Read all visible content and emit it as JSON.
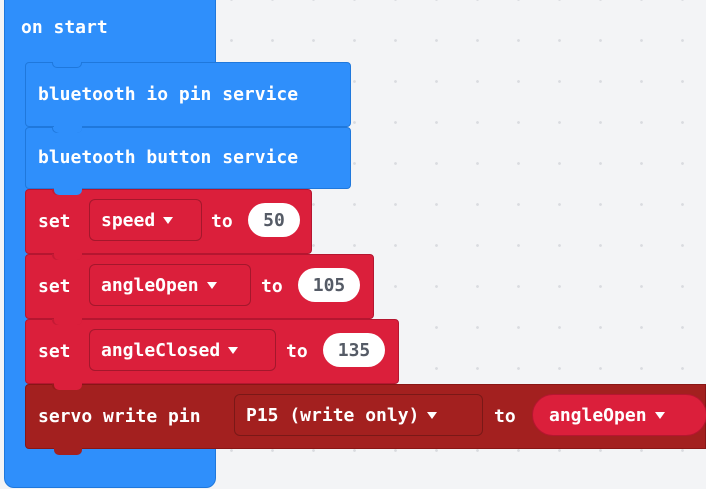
{
  "hat": {
    "label": "on start"
  },
  "bluetooth_io": {
    "label": "bluetooth io pin service"
  },
  "bluetooth_button": {
    "label": "bluetooth button service"
  },
  "set_speed": {
    "set_label": "set",
    "variable": "speed",
    "to_label": "to",
    "value": "50"
  },
  "set_angle_open": {
    "set_label": "set",
    "variable": "angleOpen",
    "to_label": "to",
    "value": "105"
  },
  "set_angle_closed": {
    "set_label": "set",
    "variable": "angleClosed",
    "to_label": "to",
    "value": "135"
  },
  "servo_write": {
    "label": "servo write pin",
    "pin": "P15 (write only)",
    "to_label": "to",
    "variable": "angleOpen"
  },
  "colors": {
    "bluetooth": "#2f8ffb",
    "variables": "#db1f3b",
    "pins": "#a3201f",
    "workspace": "#f3f4f6"
  },
  "icons": {
    "dropdown": "caret-down-icon"
  }
}
